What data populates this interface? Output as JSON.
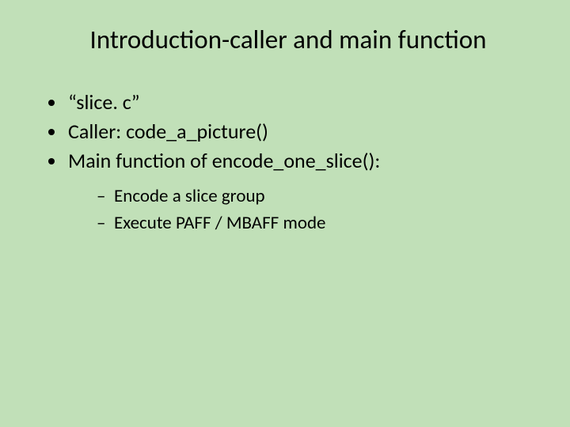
{
  "title": "Introduction-caller and main function",
  "bullets": {
    "b0": "“slice. c”",
    "b1": "Caller: code_a_picture()",
    "b2": "Main function of encode_one_slice():",
    "sub": {
      "s0": "Encode a slice group",
      "s1": "Execute PAFF / MBAFF mode"
    }
  }
}
